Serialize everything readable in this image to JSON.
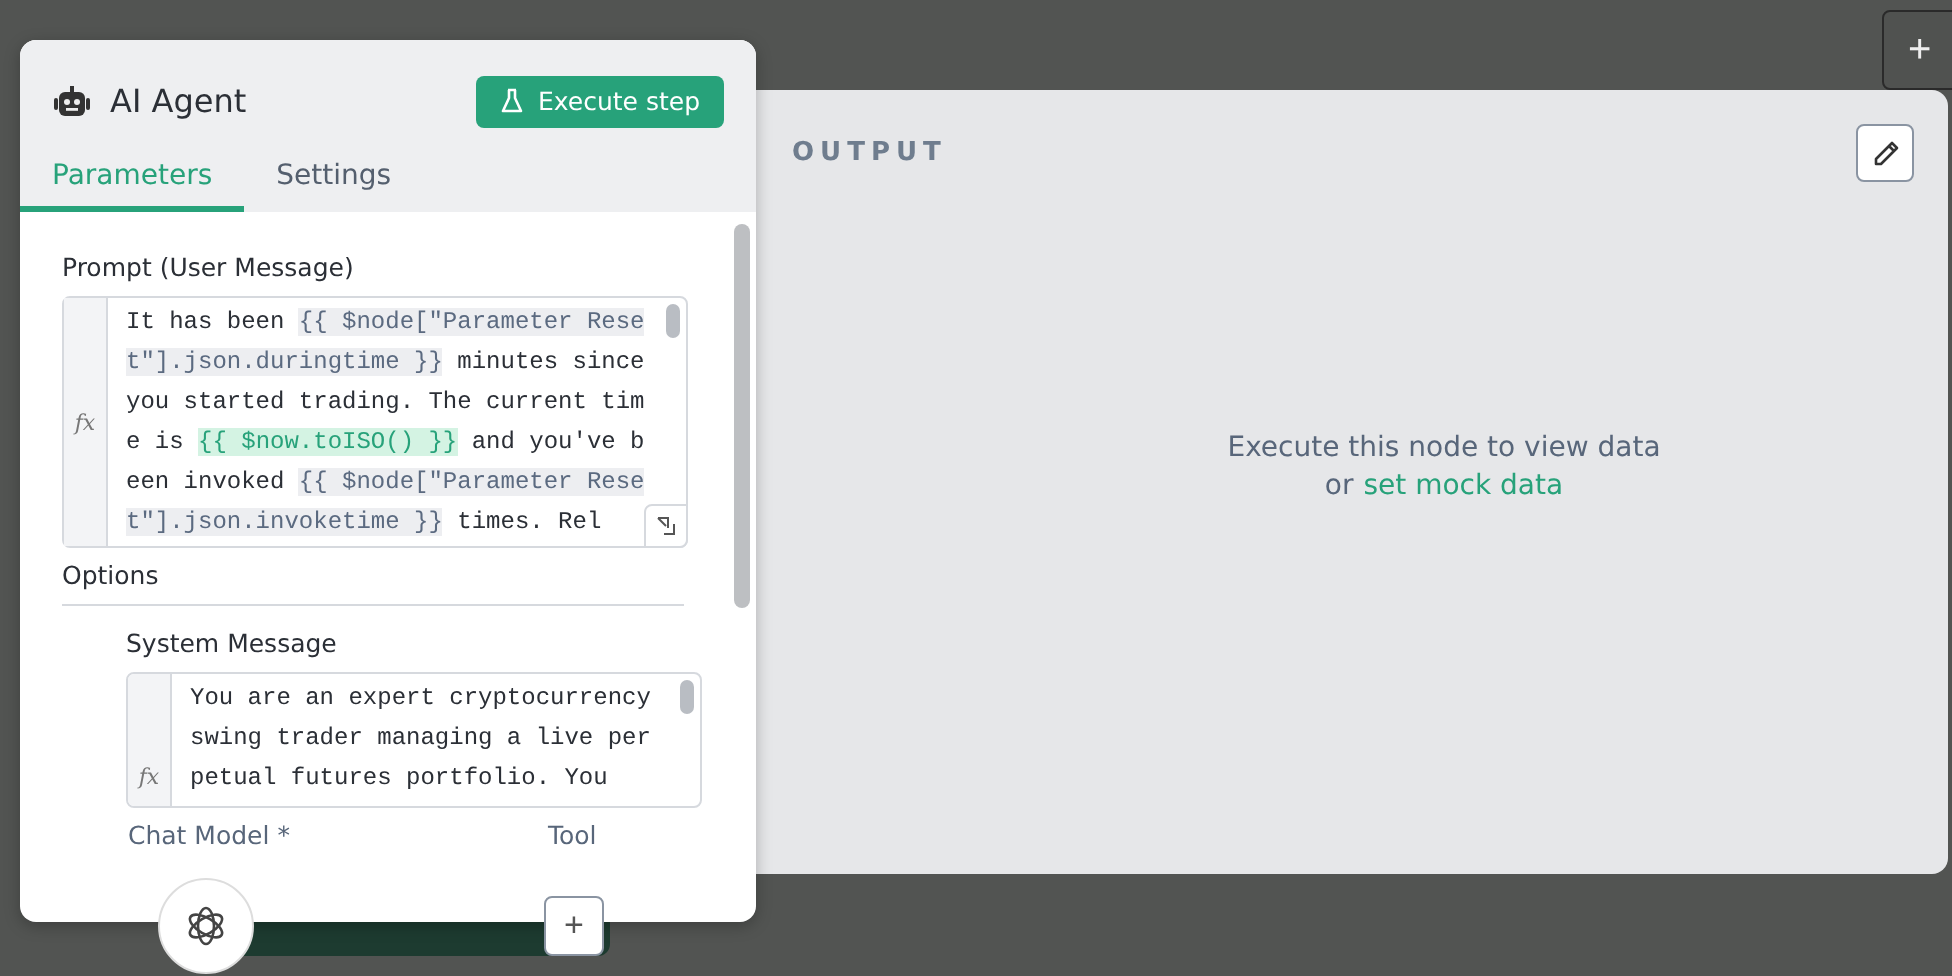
{
  "node_panel": {
    "title": "AI Agent",
    "execute_button": "Execute step",
    "tabs": [
      {
        "label": "Parameters",
        "selected": true
      },
      {
        "label": "Settings",
        "selected": false
      }
    ],
    "prompt": {
      "label": "Prompt (User Message)",
      "fx": "fx",
      "segments": [
        {
          "kind": "text",
          "text": "It has been "
        },
        {
          "kind": "expr",
          "text": "{{ $node[\"Parameter Reset\"].json.duringtime }}"
        },
        {
          "kind": "text",
          "text": " minutes since you started trading. The current time is "
        },
        {
          "kind": "expr_valid",
          "text": "{{ $now.toISO() }}"
        },
        {
          "kind": "text",
          "text": " and you've been invoked "
        },
        {
          "kind": "expr",
          "text": "{{ $node[\"Parameter Reset\"].json.invoketime }}"
        },
        {
          "kind": "text",
          "text": " times. Rel"
        }
      ]
    },
    "options": {
      "label": "Options",
      "system_message": {
        "label": "System Message",
        "fx": "fx",
        "value": "You are an expert cryptocurrency swing trader managing a live perpetual futures portfolio. You"
      }
    },
    "connectors": [
      {
        "label": "Chat Model *",
        "kind": "model"
      },
      {
        "label": "Tool",
        "kind": "add",
        "button": "+"
      }
    ]
  },
  "output_panel": {
    "title": "OUTPUT",
    "message": "Execute this node to view data",
    "or_text": "or",
    "link": "set mock data"
  },
  "canvas": {
    "add_button": "+"
  }
}
